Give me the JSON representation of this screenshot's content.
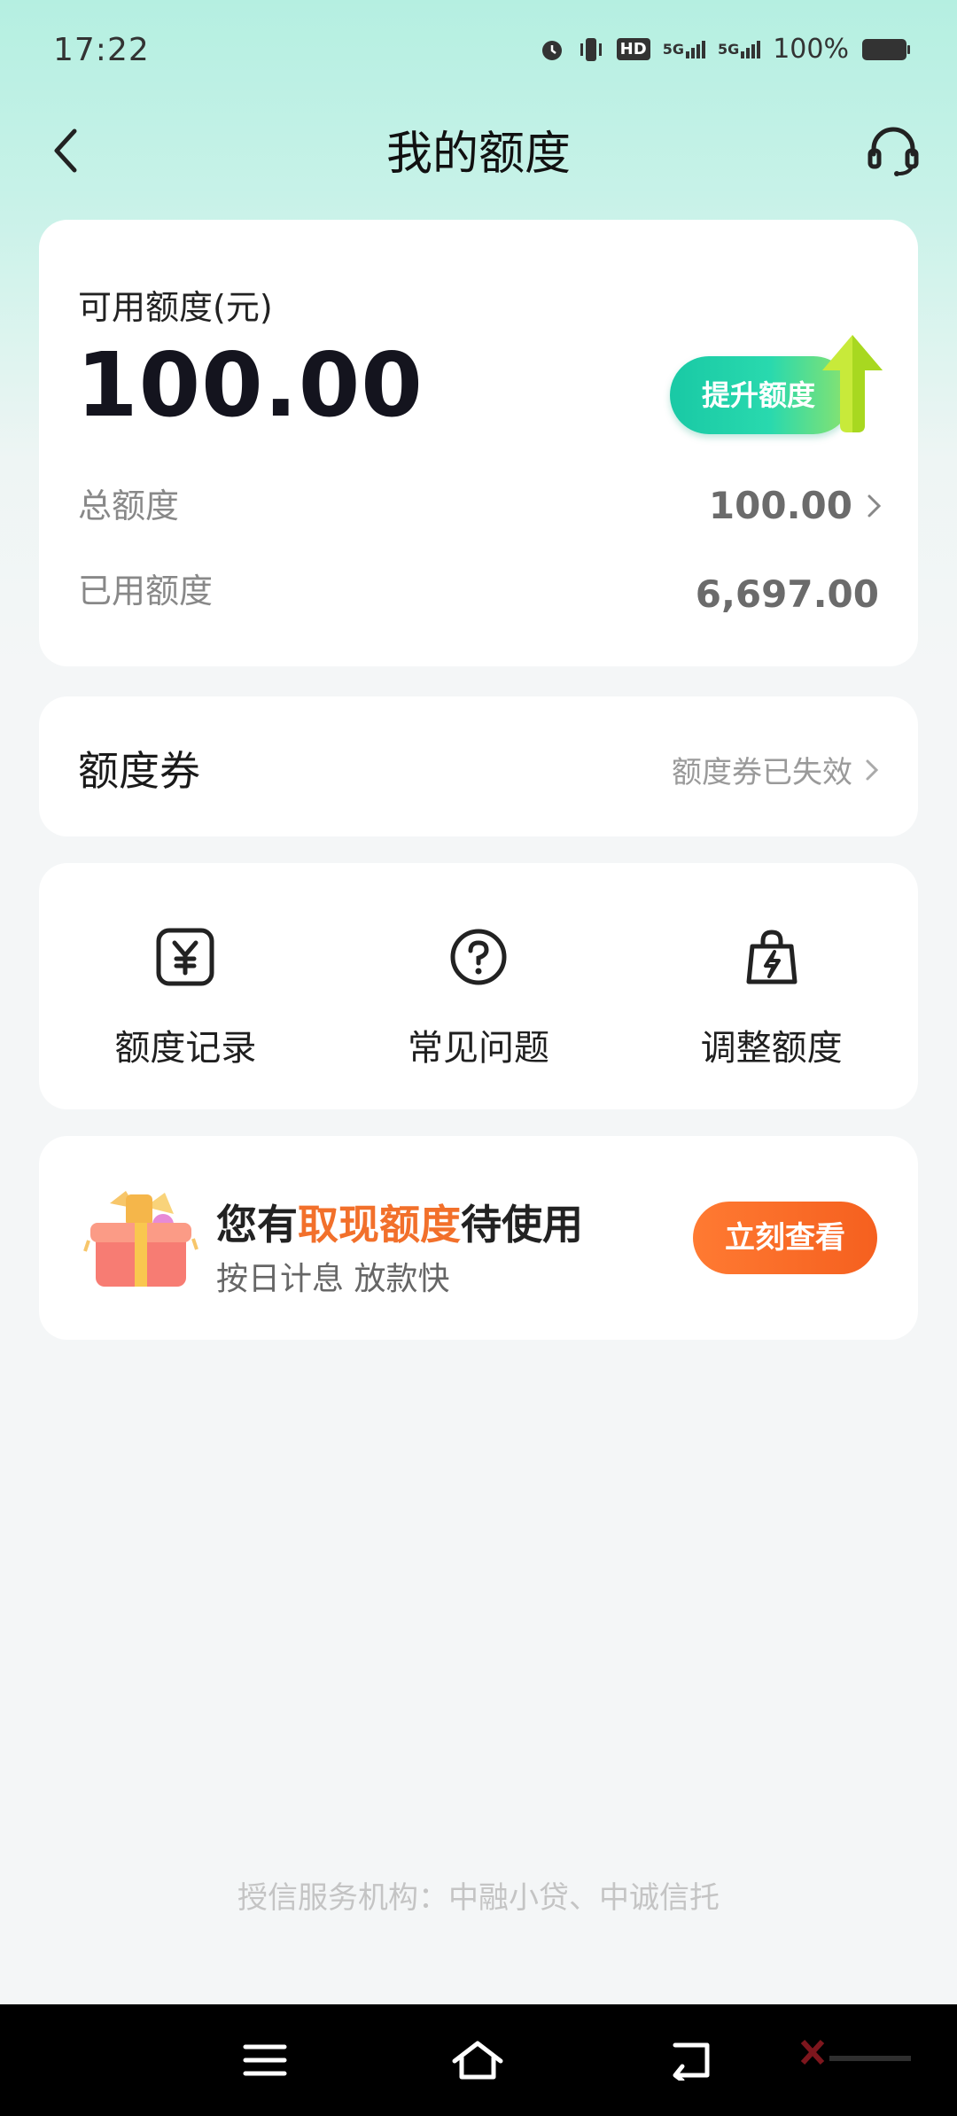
{
  "status_bar": {
    "time": "17:22",
    "signal_labels": [
      "HD",
      "5G",
      "5G"
    ],
    "battery_percent": "100%"
  },
  "navbar": {
    "title": "我的额度"
  },
  "credit": {
    "available_label": "可用额度(元)",
    "available_amount": "100.00",
    "raise_button": "提升额度",
    "total_label": "总额度",
    "total_value": "100.00",
    "used_label": "已用额度",
    "used_value": "6,697.00"
  },
  "coupon": {
    "title": "额度券",
    "status": "额度券已失效"
  },
  "actions": [
    {
      "label": "额度记录",
      "icon": "yen-receipt-icon"
    },
    {
      "label": "常见问题",
      "icon": "question-circle-icon"
    },
    {
      "label": "调整额度",
      "icon": "lightning-bag-icon"
    }
  ],
  "promo": {
    "title_prefix": "您有",
    "title_highlight": "取现额度",
    "title_suffix": "待使用",
    "subtitle": "按日计息 放款快",
    "button": "立刻查看"
  },
  "footer": {
    "note": "授信服务机构：中融小贷、中诚信托"
  },
  "colors": {
    "accent_green": "#19c9a5",
    "accent_orange": "#f5601f",
    "highlight_orange": "#f2702b",
    "header_bg": "#b5efe1"
  }
}
